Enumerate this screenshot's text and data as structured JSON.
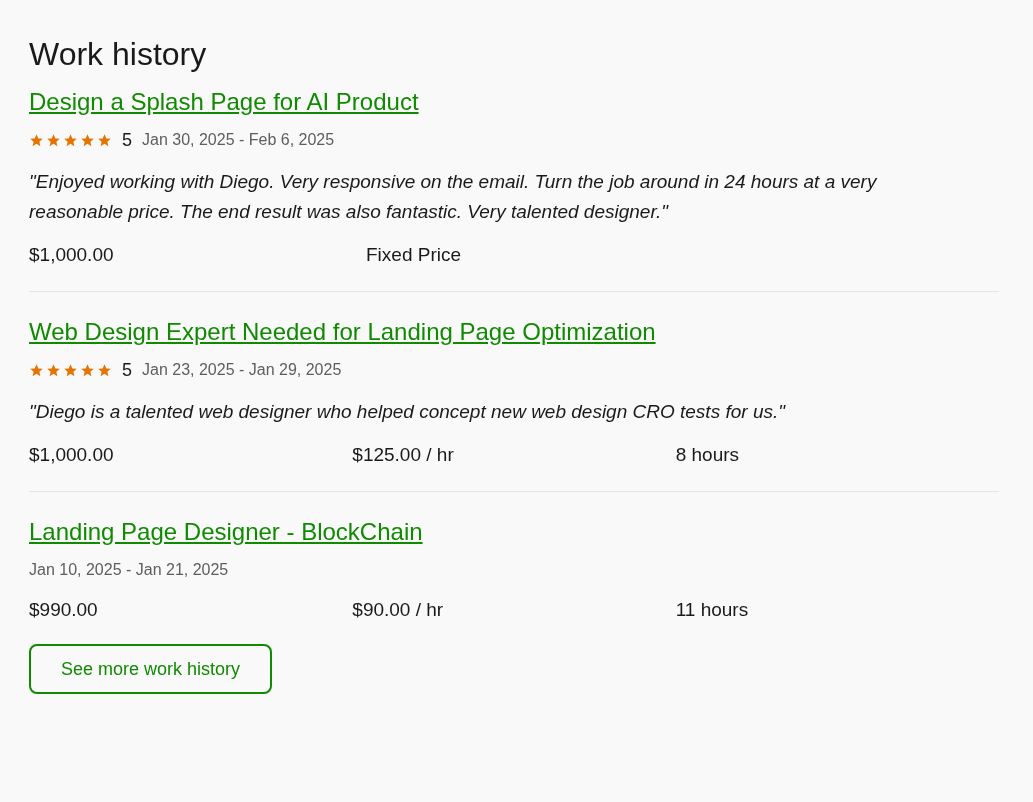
{
  "heading": "Work history",
  "jobs": [
    {
      "title": "Design a Splash Page for AI Product",
      "stars": 5,
      "rating": "5",
      "dates": "Jan 30, 2025 - Feb 6, 2025",
      "review": "\"Enjoyed working with Diego. Very responsive on the email. Turn the job around in 24 hours at a very reasonable price. The end result was also fantastic. Very talented designer.\"",
      "details": [
        "$1,000.00",
        "Fixed Price"
      ]
    },
    {
      "title": "Web Design Expert Needed for Landing Page Optimization",
      "stars": 5,
      "rating": "5",
      "dates": "Jan 23, 2025 - Jan 29, 2025",
      "review": "\"Diego is a talented web designer who helped concept new web design CRO tests for us.\"",
      "details": [
        "$1,000.00",
        "$125.00 / hr",
        "8 hours"
      ]
    },
    {
      "title": "Landing Page Designer - BlockChain",
      "dates": "Jan 10, 2025 - Jan 21, 2025",
      "details": [
        "$990.00",
        "$90.00 / hr",
        "11 hours"
      ]
    }
  ],
  "button": {
    "label": "See more work history"
  }
}
